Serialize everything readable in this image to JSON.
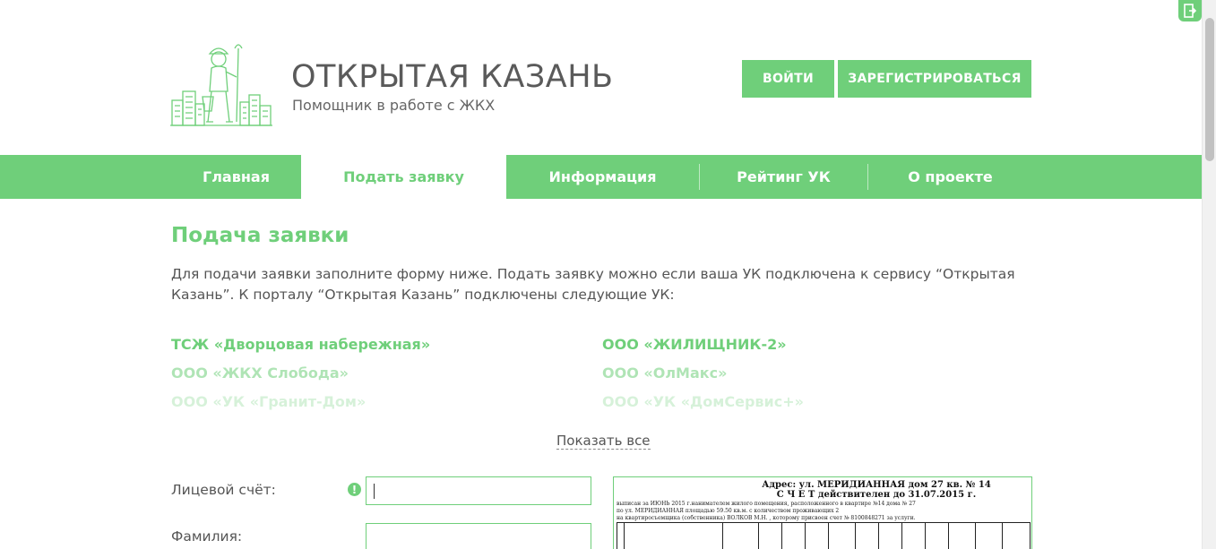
{
  "header": {
    "title": "ОТКРЫТАЯ КАЗАНЬ",
    "subtitle": "Помощник в работе с ЖКХ",
    "login_label": "ВОЙТИ",
    "register_label": "ЗАРЕГИСТРИРОВАТЬСЯ"
  },
  "nav": {
    "items": [
      {
        "label": "Главная"
      },
      {
        "label": "Подать заявку",
        "active": true
      },
      {
        "label": "Информация"
      },
      {
        "label": "Рейтинг УК"
      },
      {
        "label": "О проекте"
      }
    ]
  },
  "main": {
    "title": "Подача заявки",
    "intro": "Для подачи заявки заполните форму ниже. Подать заявку можно если ваша УК подключена к сервису “Открытая Казань”. К порталу “Открытая Казань” подключены следующие УК:",
    "uk_left": [
      "ТСЖ «Дворцовая набережная»",
      "ООО «ЖКХ Слобода»",
      "ООО «УК «Гранит-Дом»"
    ],
    "uk_right": [
      "ООО «ЖИЛИЩНИК-2»",
      "ООО «ОлМакс»",
      "ООО «УК «ДомСервис+»"
    ],
    "show_all": "Показать все"
  },
  "form": {
    "account_label": "Лицевой счёт:",
    "account_value": "",
    "surname_label": "Фамилия:",
    "surname_value": ""
  },
  "bill": {
    "address": "Адрес: ул. МЕРИДИАННАЯ дом 27 кв. № 14",
    "heading": "С Ч Е Т действителен до 31.07.2015 г.",
    "line1": "выписан за ИЮНЬ 2015 г.нанимателем жилого помещения, расположенного в квартире №14 дома № 27",
    "line2": "по ул. МЕРИДИАННАЯ площадью 59.50 кв.м. с количеством проживающих 2",
    "line3": "на квартиросъемщика (собственника) ВОЛКОВ М.Н. , которому присвоен счет № 8100848271 за услуги."
  },
  "colors": {
    "accent": "#6fcf7a",
    "text": "#555555"
  },
  "icons": {
    "corner": "exit-door-icon",
    "warning": "exclamation-icon",
    "logo": "worker-city-logo"
  }
}
